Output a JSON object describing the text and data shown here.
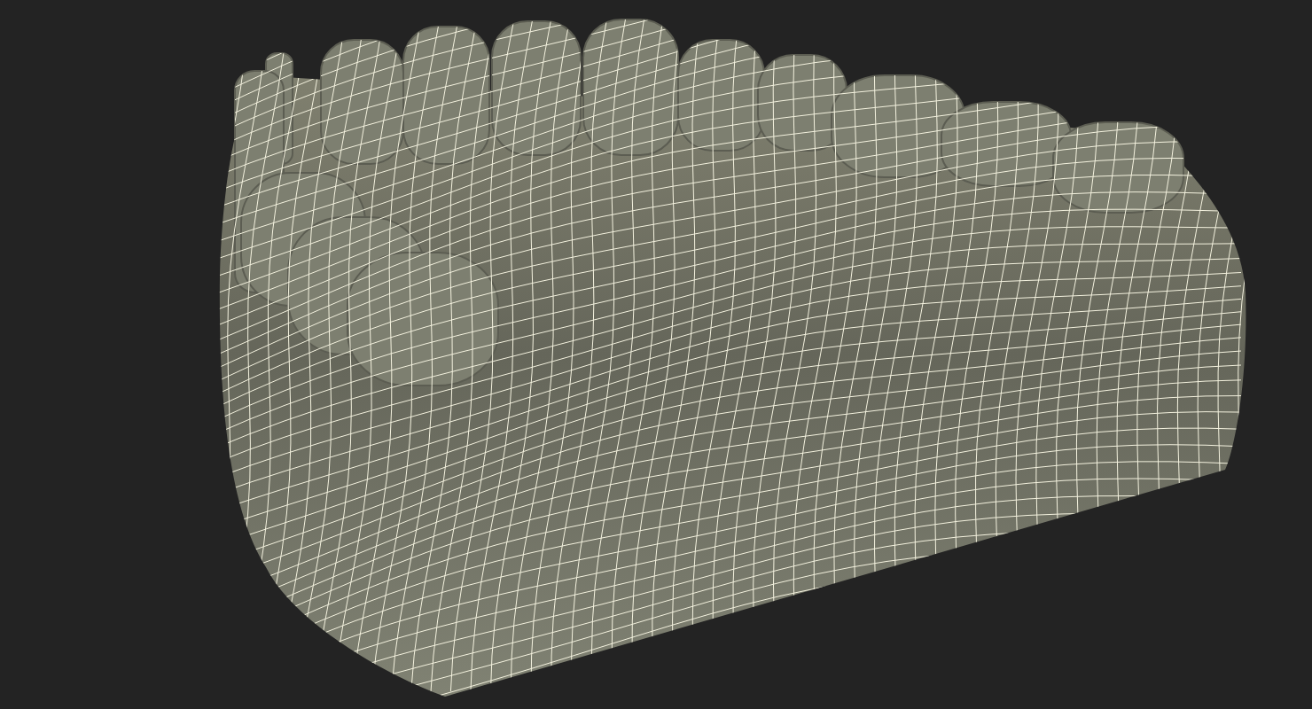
{
  "viewport": {
    "kind": "wireframe_render"
  }
}
